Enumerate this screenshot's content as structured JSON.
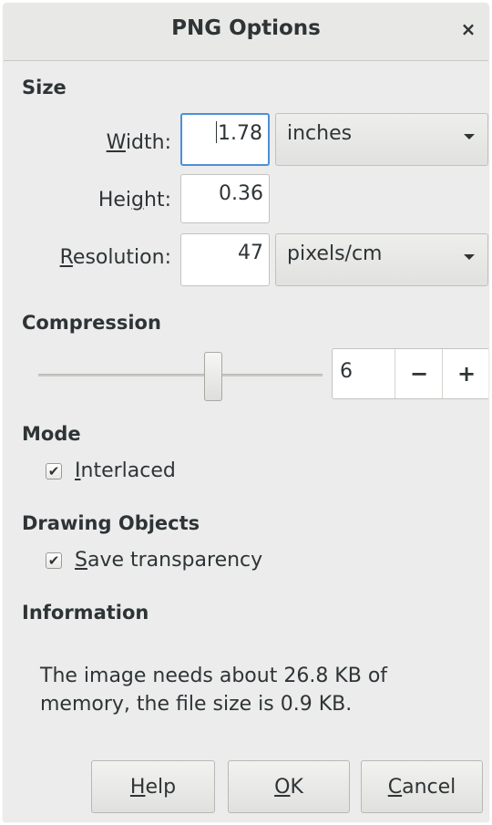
{
  "dialog": {
    "title": "PNG Options",
    "close_glyph": "×"
  },
  "size": {
    "section_label": "Size",
    "width_label_u": "W",
    "width_label_rest": "idth:",
    "width_value": "1.78",
    "width_unit": "inches",
    "height_label_pre": "Hei",
    "height_label_u": "g",
    "height_label_post": "ht:",
    "height_value": "0.36",
    "resolution_label_u": "R",
    "resolution_label_rest": "esolution:",
    "resolution_value": "47",
    "resolution_unit": "pixels/cm"
  },
  "compression": {
    "section_label": "Compression",
    "value": "6",
    "min": 0,
    "max": 9,
    "minus_glyph": "−",
    "plus_glyph": "+"
  },
  "mode": {
    "section_label": "Mode",
    "interlaced_u": "I",
    "interlaced_rest": "nterlaced",
    "interlaced_checked": true
  },
  "drawing_objects": {
    "section_label": "Drawing Objects",
    "transparency_u": "S",
    "transparency_rest": "ave transparency",
    "transparency_checked": true
  },
  "information": {
    "section_label": "Information",
    "text": "The image needs about 26.8 KB of memory, the file size is 0.9 KB."
  },
  "buttons": {
    "help_u": "H",
    "help_rest": "elp",
    "ok_u": "O",
    "ok_rest": "K",
    "cancel_u": "C",
    "cancel_rest": "ancel"
  },
  "check_glyph": "✔",
  "colors": {
    "focus_border": "#4a90d9",
    "dialog_bg": "#ececec"
  }
}
